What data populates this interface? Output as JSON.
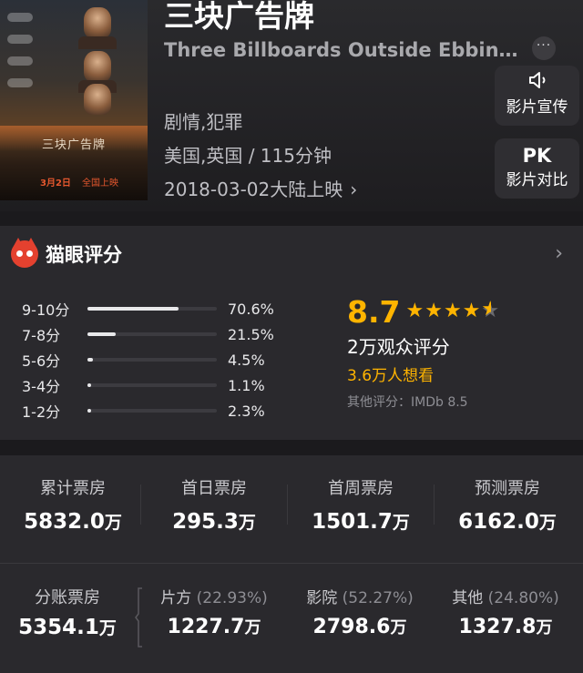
{
  "movie": {
    "title_cn": "三块广告牌",
    "title_en": "Three Billboards Outside Ebbing,...",
    "genre": "剧情,犯罪",
    "region_duration": "美国,英国 / 115分钟",
    "release": "2018-03-02大陆上映",
    "more_label": "···",
    "poster_title": "三块广告牌",
    "poster_date": "3月2日",
    "poster_date2": "全国上映"
  },
  "actions": {
    "promo_label": "影片宣传",
    "compare_icon_text": "PK",
    "compare_label": "影片对比"
  },
  "rating": {
    "brand_label": "猫眼评分",
    "score": "8.7",
    "stars": 4.35,
    "count_text": "2万观众评分",
    "want_text": "3.6万人想看",
    "other_text": "其他评分：IMDb 8.5",
    "distribution": [
      {
        "range": "9-10分",
        "pct_text": "70.6%",
        "pct": 70.6
      },
      {
        "range": "7-8分",
        "pct_text": "21.5%",
        "pct": 21.5
      },
      {
        "range": "5-6分",
        "pct_text": "4.5%",
        "pct": 4.5
      },
      {
        "range": "3-4分",
        "pct_text": "1.1%",
        "pct": 1.1
      },
      {
        "range": "1-2分",
        "pct_text": "2.3%",
        "pct": 2.3
      }
    ]
  },
  "box_office": {
    "unit": "万",
    "top": [
      {
        "label": "累计票房",
        "value": "5832.0"
      },
      {
        "label": "首日票房",
        "value": "295.3"
      },
      {
        "label": "首周票房",
        "value": "1501.7"
      },
      {
        "label": "预测票房",
        "value": "6162.0"
      }
    ],
    "split_total": {
      "label": "分账票房",
      "value": "5354.1"
    },
    "split": [
      {
        "label": "片方",
        "pct": "(22.93%)",
        "value": "1227.7"
      },
      {
        "label": "影院",
        "pct": "(52.27%)",
        "value": "2798.6"
      },
      {
        "label": "其他",
        "pct": "(24.80%)",
        "value": "1327.8"
      }
    ]
  },
  "colors": {
    "accent": "#ffb400",
    "brand_red": "#e4412f",
    "background": "#1b1a1d",
    "card": "#2a292d"
  },
  "icons": {
    "promo": "speaker-icon",
    "rating_brand": "maoyan-cat-icon",
    "chevron": "chevron-right-icon"
  }
}
